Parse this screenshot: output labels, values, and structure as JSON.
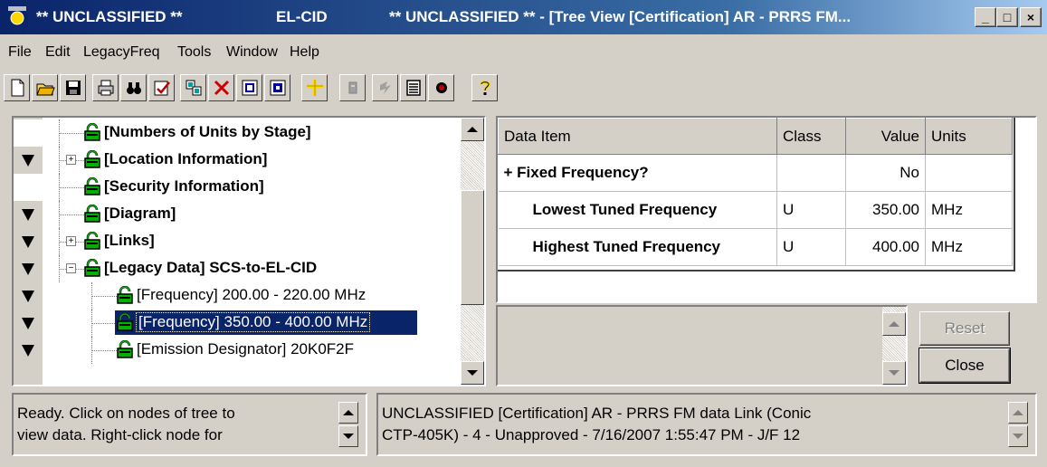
{
  "window": {
    "classification_left": "** UNCLASSIFIED **",
    "app_name": "EL-CID",
    "title": "** UNCLASSIFIED ** - [Tree View [Certification] AR - PRRS FM...",
    "minimize": "_",
    "maximize": "□",
    "close": "×"
  },
  "menu": {
    "file": "File",
    "edit": "Edit",
    "legacyfreq": "LegacyFreq",
    "tools": "Tools",
    "window": "Window",
    "help": "Help"
  },
  "toolbar": {
    "icons": [
      "new-document-icon",
      "open-folder-icon",
      "save-disk-icon",
      "print-icon",
      "find-binoculars-icon",
      "check-list-icon",
      "copy-structure-icon",
      "delete-x-icon",
      "copy-record-icon",
      "paste-record-icon",
      "add-cross-icon",
      "disabled-form-icon",
      "disabled-refresh-icon",
      "list-view-icon",
      "record-filter-icon",
      "help-question-icon"
    ]
  },
  "tree": {
    "nodes": [
      {
        "label": "[Numbers of Units by Stage]",
        "bold": true,
        "expander": "",
        "level": 1
      },
      {
        "label": "[Location Information]",
        "bold": true,
        "expander": "+",
        "level": 1
      },
      {
        "label": "[Security Information]",
        "bold": true,
        "expander": "",
        "level": 1
      },
      {
        "label": "[Diagram]",
        "bold": true,
        "expander": "",
        "level": 1
      },
      {
        "label": "[Links]",
        "bold": true,
        "expander": "+",
        "level": 1
      },
      {
        "label": "[Legacy Data] SCS-to-EL-CID",
        "bold": true,
        "expander": "-",
        "level": 1
      },
      {
        "label": "[Frequency] 200.00 - 220.00 MHz",
        "bold": false,
        "expander": "",
        "level": 2
      },
      {
        "label": "[Frequency] 350.00 - 400.00 MHz",
        "bold": false,
        "expander": "",
        "level": 2,
        "selected": true
      },
      {
        "label": "[Emission Designator] 20K0F2F",
        "bold": false,
        "expander": "",
        "level": 2
      }
    ],
    "gutter_markers": [
      false,
      true,
      false,
      true,
      true,
      true,
      true,
      true,
      true
    ]
  },
  "grid": {
    "columns": {
      "item": "Data Item",
      "class": "Class",
      "value": "Value",
      "units": "Units"
    },
    "rows": [
      {
        "item": "+ Fixed Frequency?",
        "class": "",
        "value": "No",
        "units": "",
        "indent": false
      },
      {
        "item": "Lowest Tuned Frequency",
        "class": "U",
        "value": "350.00",
        "units": "MHz",
        "indent": true
      },
      {
        "item": "Highest Tuned Frequency",
        "class": "U",
        "value": "400.00",
        "units": "MHz",
        "indent": true
      }
    ]
  },
  "buttons": {
    "reset": "Reset",
    "close": "Close"
  },
  "status": {
    "left": "Ready.  Click on nodes of tree to\nview data.  Right-click node for",
    "right": "UNCLASSIFIED [Certification] AR - PRRS FM data Link (Conic\nCTP-405K) - 4 - Unapproved - 7/16/2007 1:55:47 PM - J/F 12"
  }
}
